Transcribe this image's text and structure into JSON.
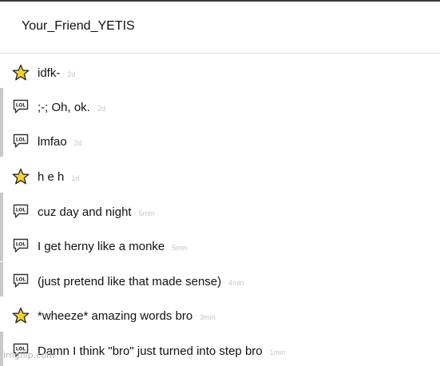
{
  "header": {
    "username": "Your_Friend_YETIS"
  },
  "colors": {
    "star": "#f2d52b",
    "star_outline": "#222222",
    "left_bar": "#c9c9c9",
    "timestamp": "#c6c6c6"
  },
  "comments": [
    {
      "icon": "star-icon",
      "text": "idfk-",
      "time": "2d"
    },
    {
      "icon": "lol-speech-bubble-icon",
      "text": ";-; Oh, ok.",
      "time": "2d"
    },
    {
      "icon": "lol-speech-bubble-icon",
      "text": "lmfao",
      "time": "2d"
    },
    {
      "icon": "star-icon",
      "text": "h e h",
      "time": "1d"
    },
    {
      "icon": "lol-speech-bubble-icon",
      "text": "cuz day and night",
      "time": "5min"
    },
    {
      "icon": "lol-speech-bubble-icon",
      "text": "I get herny like a monke",
      "time": "5min"
    },
    {
      "icon": "lol-speech-bubble-icon",
      "text": "(just pretend like that made sense)",
      "time": "4min"
    },
    {
      "icon": "star-icon",
      "text": "*wheeze* amazing words bro",
      "time": "3min"
    },
    {
      "icon": "lol-speech-bubble-icon",
      "text": "Damn I think \"bro\" just turned into step bro",
      "time": "1min"
    }
  ],
  "watermark": "imgflip.com"
}
